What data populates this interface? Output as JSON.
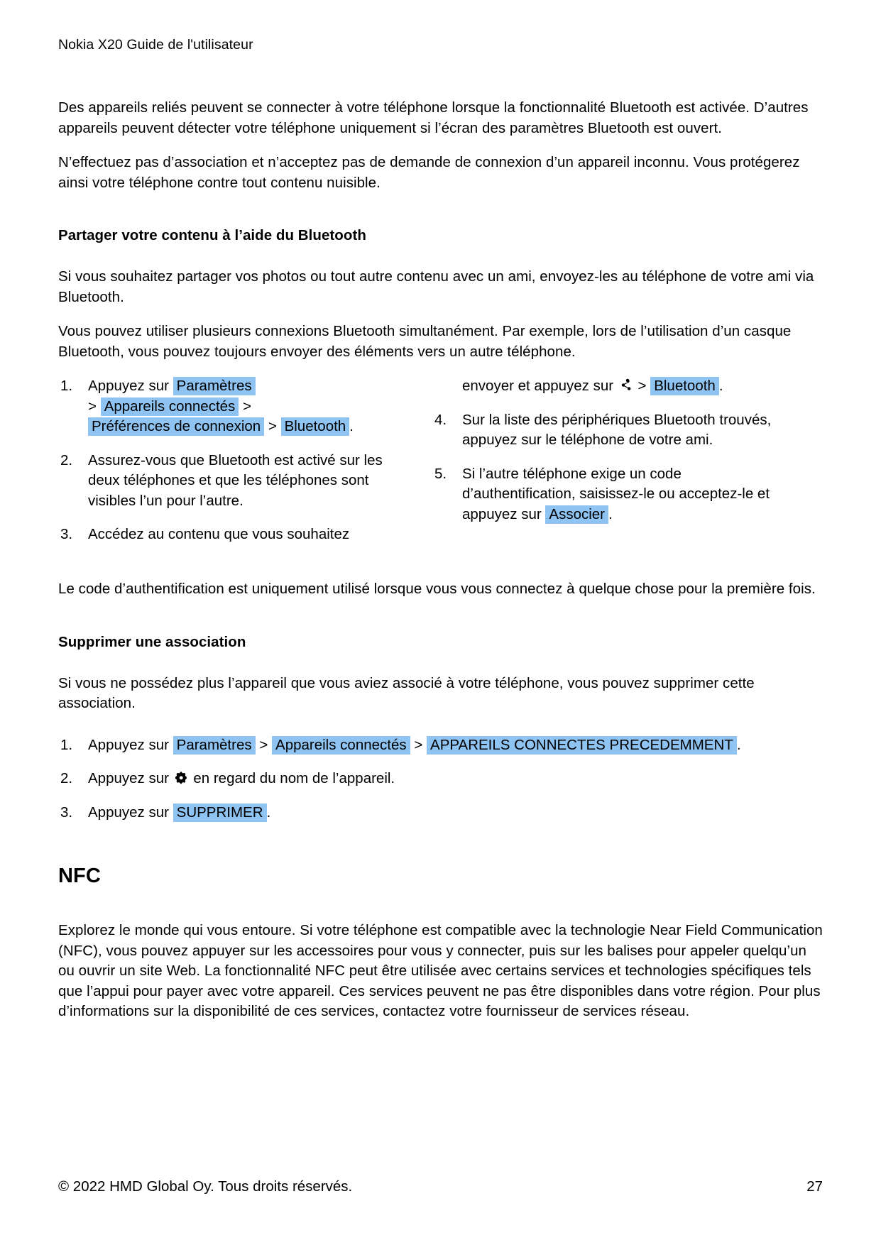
{
  "document": {
    "running_head": "Nokia X20 Guide de l'utilisateur",
    "footer": {
      "copyright": "© 2022 HMD Global Oy. Tous droits réservés.",
      "page_number": "27"
    }
  },
  "colors": {
    "highlight": "#8ec3f2",
    "text": "#000000",
    "background": "#ffffff"
  },
  "intro": {
    "paragraph_1": "Des appareils reliés peuvent se connecter à votre téléphone lorsque la fonctionnalité Bluetooth est activée. D’autres appareils peuvent détecter votre téléphone uniquement si l’écran des paramètres Bluetooth est ouvert.",
    "paragraph_2": "N’effectuez pas d’association et n’acceptez pas de demande de connexion d’un appareil inconnu. Vous protégerez ainsi votre téléphone contre tout contenu nuisible."
  },
  "share_section": {
    "heading": "Partager votre contenu à l’aide du Bluetooth",
    "paragraph_1": "Si vous souhaitez partager vos photos ou tout autre contenu avec un ami, envoyez-les au téléphone de votre ami via Bluetooth.",
    "paragraph_2": "Vous pouvez utiliser plusieurs connexions Bluetooth simultanément. Par exemple, lors de l’utilisation d’un casque Bluetooth, vous pouvez toujours envoyer des éléments vers un autre téléphone.",
    "step1": {
      "lead": "Appuyez sur",
      "chip_1": "Paramètres",
      "sep_1": ">",
      "chip_2": "Appareils connectés",
      "sep_2": ">",
      "chip_3": "Préférences de connexion",
      "sep_3": ">",
      "chip_4": "Bluetooth",
      "tail": "."
    },
    "step2": "Assurez-vous que Bluetooth est activé sur les deux téléphones et que les téléphones sont visibles l’un pour l’autre.",
    "step3": {
      "text_part_1": "Accédez au contenu que vous souhaitez",
      "text_part_2": "envoyer et appuyez sur",
      "icon": "share-icon",
      "sep": ">",
      "chip": "Bluetooth",
      "tail": "."
    },
    "step4": "Sur la liste des périphériques Bluetooth trouvés, appuyez sur le téléphone de votre ami.",
    "step5": {
      "text": "Si l’autre téléphone exige un code d’authentification, saisissez-le ou acceptez-le et appuyez sur",
      "chip": "Associer",
      "tail": "."
    },
    "paragraph_after": "Le code d’authentification est uniquement utilisé lorsque vous vous connectez à quelque chose pour la première fois."
  },
  "unpair_section": {
    "heading": "Supprimer une association",
    "paragraph_1": "Si vous ne possédez plus l’appareil que vous aviez associé à votre téléphone, vous pouvez supprimer cette association.",
    "step1": {
      "lead": "Appuyez sur",
      "chip_1": "Paramètres",
      "sep_1": ">",
      "chip_2": "Appareils connectés",
      "sep_2": ">",
      "chip_3": "APPAREILS CONNECTES PRECEDEMMENT",
      "tail": "."
    },
    "step2": {
      "lead": "Appuyez sur",
      "icon": "gear-icon",
      "tail": "en regard du nom de l’appareil."
    },
    "step3": {
      "lead": "Appuyez sur",
      "chip": "SUPPRIMER",
      "tail": "."
    }
  },
  "nfc_section": {
    "heading": "NFC",
    "paragraph_1": "Explorez le monde qui vous entoure. Si votre téléphone est compatible avec la technologie Near Field Communication (NFC), vous pouvez appuyer sur les accessoires pour vous y connecter, puis sur les balises pour appeler quelqu’un ou ouvrir un site Web. La fonctionnalité NFC peut être utilisée avec certains services et technologies spécifiques tels que l’appui pour payer avec votre appareil. Ces services peuvent ne pas être disponibles dans votre région. Pour plus d’informations sur la disponibilité de ces services, contactez votre fournisseur de services réseau."
  }
}
